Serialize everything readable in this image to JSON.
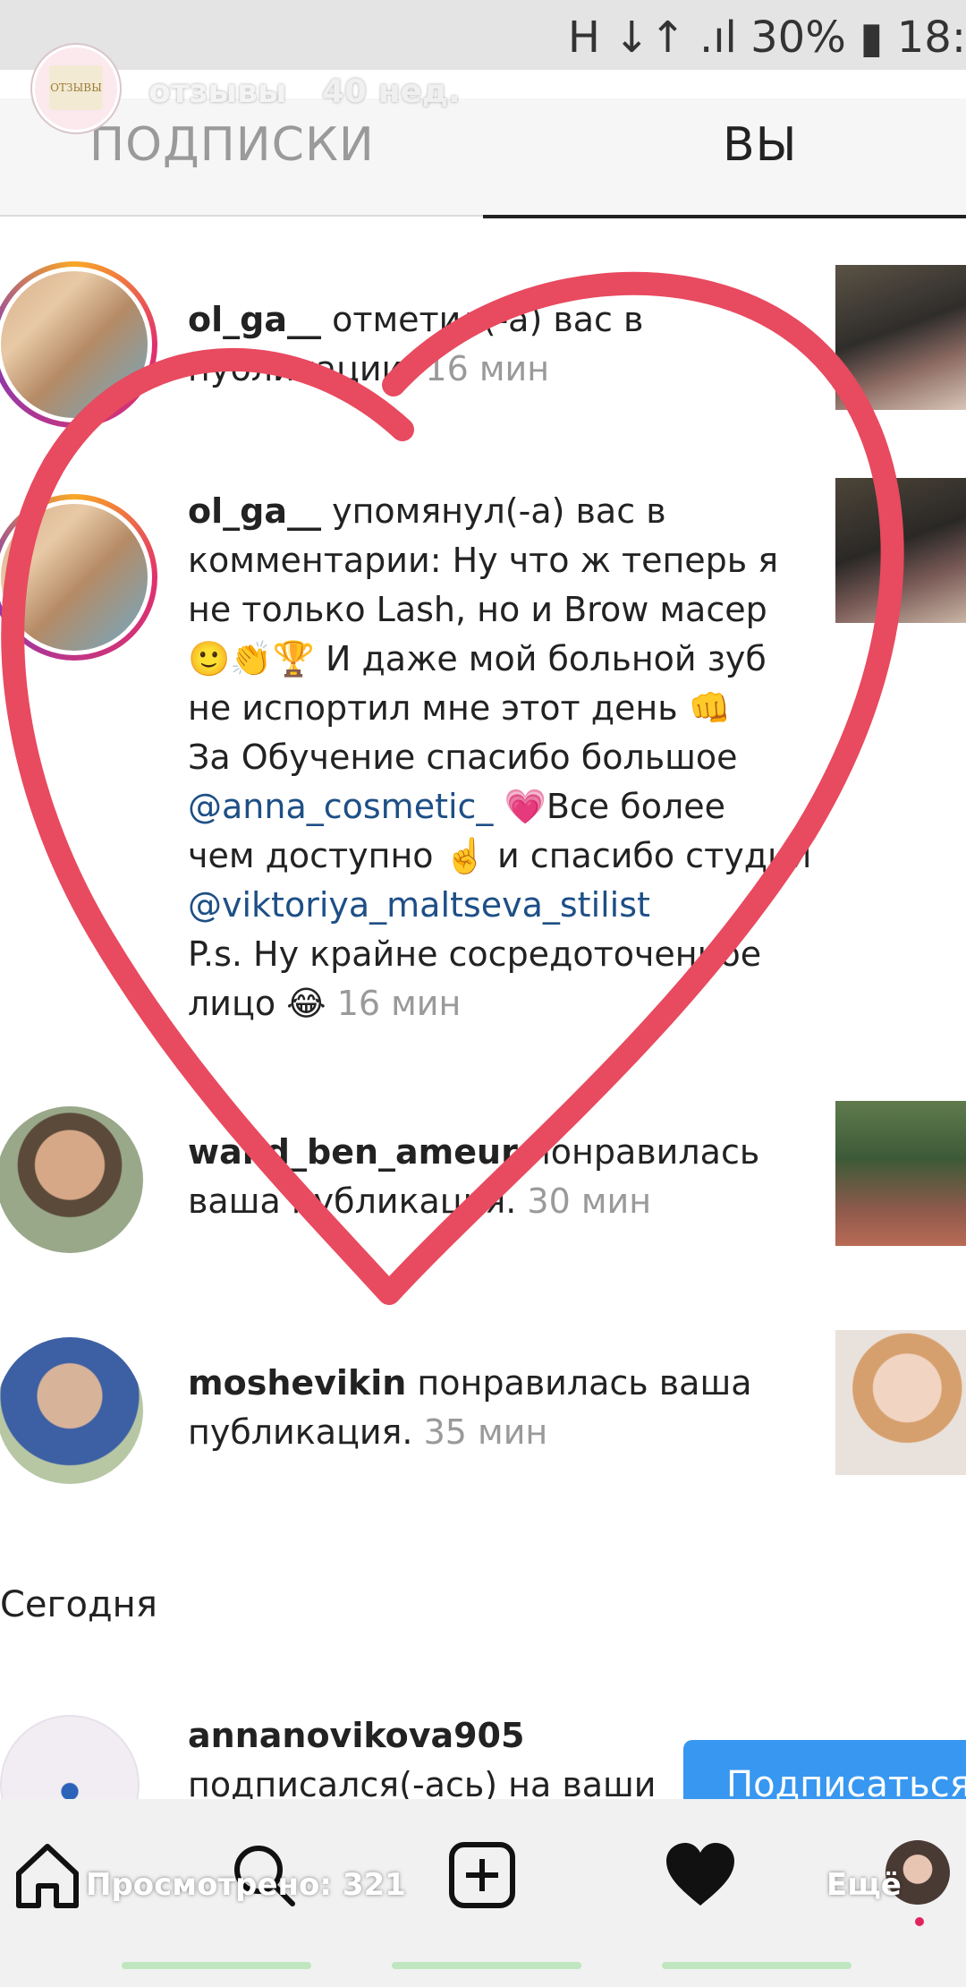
{
  "status_bar": {
    "text": "H ↓↑ .ıl 30% ▮ 18:"
  },
  "story": {
    "account_name": "отзывы",
    "age": "40 нед.",
    "avatar_text": "ОТЗЫВЫ"
  },
  "tabs": [
    {
      "label": "ПОДПИСКИ"
    },
    {
      "label": "ВЫ"
    }
  ],
  "notifications": [
    {
      "username": "ol_ga__",
      "text": "отметил(-а) вас в",
      "tail": "публикации.",
      "time": "16 мин"
    },
    {
      "username": "ol_ga__",
      "lines": [
        "упомянул(-а) вас в",
        "комментарии: Ну что ж теперь я",
        "не только Lash, но и Brow масер",
        "🙂👏🏆 И даже мой больной зуб",
        "не испортил мне этот день 👊",
        "За Обучение спасибо большое"
      ],
      "mention1": "@anna_cosmetic_",
      "after_mention1": "💗Все более",
      "line_after": "чем доступно ☝️ и спасибо студии",
      "mention2": "@viktoriya_maltseva_stilist",
      "ps": "P.s. Ну крайне сосредоточенное",
      "end": "лицо 😂",
      "time": "16 мин"
    },
    {
      "username": "walid_ben_ameur",
      "text": "понравилась",
      "line2": "ваша публикация.",
      "time": "30 мин"
    },
    {
      "username": "moshevikin",
      "text": "понравилась ваша",
      "line2": "публикация.",
      "time": "35 мин"
    }
  ],
  "section_today": "Сегодня",
  "follow_item": {
    "username": "annanovikova905",
    "text": "подписался(-ась) на ваши",
    "button": "Подписаться"
  },
  "bottom": {
    "views": "Просмотрено: 321",
    "more": "Ещё"
  },
  "colors": {
    "heart": "#e84a5f",
    "mention": "#1e4f86",
    "accent": "#3897f0"
  },
  "icons": [
    "home-icon",
    "search-icon",
    "add-icon",
    "heart-icon",
    "profile-avatar"
  ]
}
